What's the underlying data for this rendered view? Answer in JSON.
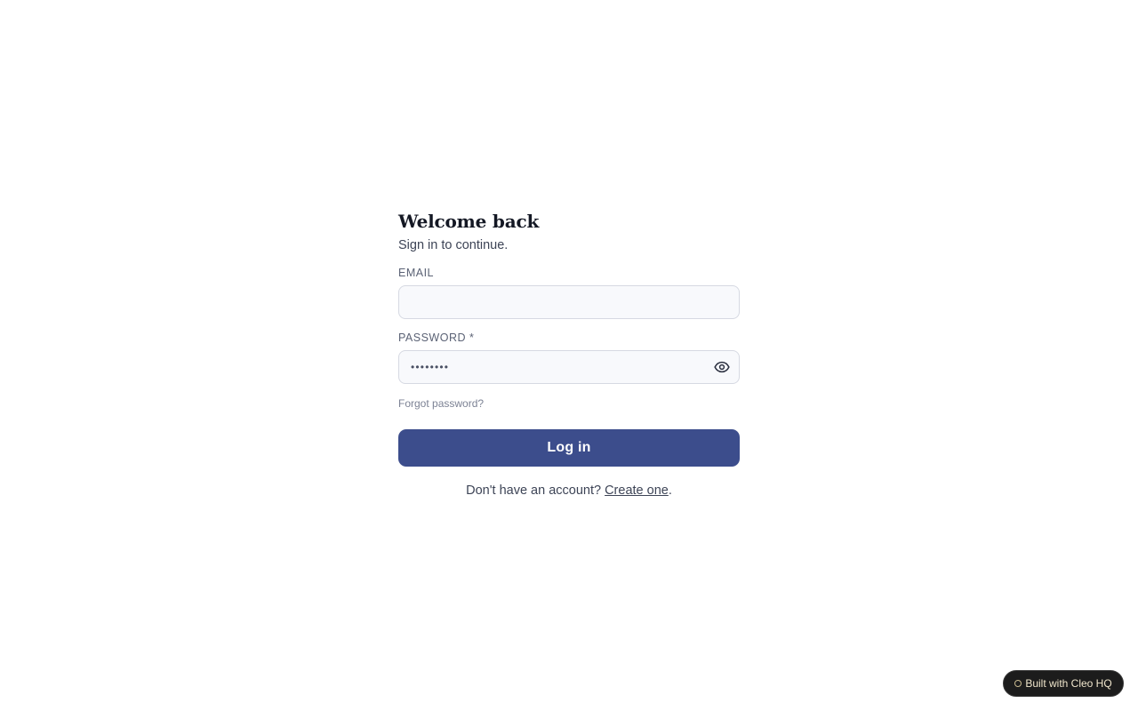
{
  "login": {
    "title": "Welcome back",
    "subtitle": "Sign in to continue.",
    "email_label": "EMAIL",
    "email_value": "",
    "email_placeholder": "",
    "password_label": "PASSWORD",
    "password_required_mark": "*",
    "password_mask": "••••••••",
    "password_toggle_icon": "eye-icon",
    "forgot_link": "Forgot password?",
    "submit_label": "Log in",
    "signup_prompt": "Don't have an account?",
    "signup_link": "Create one",
    "signup_suffix": "."
  },
  "badge": {
    "label": "Built with Cleo HQ"
  },
  "colors": {
    "primary_button": "#3c4d8c",
    "input_background": "#f8f9fc",
    "input_border": "#d6d9e2",
    "badge_background": "#1c1c1c",
    "badge_text": "#f0e6cc"
  }
}
